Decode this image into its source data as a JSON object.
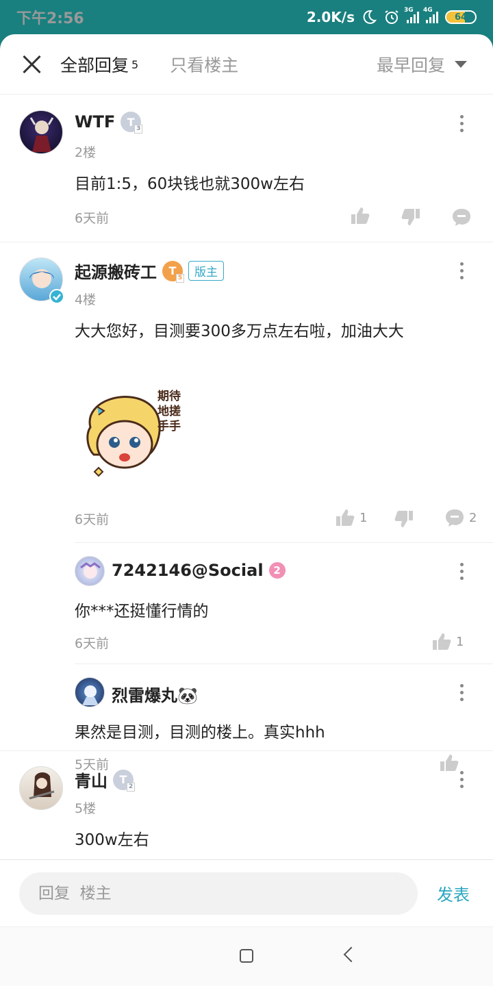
{
  "status": {
    "time": "下午2:56",
    "speed": "2.0K/s",
    "net1": "3G",
    "net2": "4G",
    "battery": "64",
    "battery_level": 0.64
  },
  "header": {
    "tab_all": "全部回复",
    "tab_all_count": "5",
    "tab_op": "只看楼主",
    "sort": "最早回复"
  },
  "posts": [
    {
      "name": "WTF",
      "level": "T",
      "level_sub": "3",
      "floor": "2楼",
      "content": "目前1:5，60块钱也就300w左右",
      "time": "6天前"
    },
    {
      "name": "起源搬砖工",
      "level": "T",
      "level_sub": "5",
      "moderator": "版主",
      "floor": "4楼",
      "content": "大大您好，目测要300多万点左右啦，加油大大",
      "sticker_text": "期待地搓手手",
      "time": "6天前",
      "likes": "1",
      "comments": "2",
      "replies": [
        {
          "name": "7242146@Social",
          "level": "2",
          "content": "你***还挺懂行情的",
          "time": "6天前",
          "likes": "1"
        },
        {
          "name": "烈雷爆丸🐼",
          "content": "果然是目测，目测的楼上。真实hhh",
          "time": "5天前"
        }
      ]
    },
    {
      "name": "青山",
      "level": "T",
      "level_sub": "2",
      "floor": "5楼",
      "content": "300w左右"
    }
  ],
  "reply": {
    "placeholder": "回复  楼主",
    "send": "发表"
  },
  "colors": {
    "brand": "#19807f",
    "accent": "#2aa6c2",
    "muted": "#999999"
  }
}
